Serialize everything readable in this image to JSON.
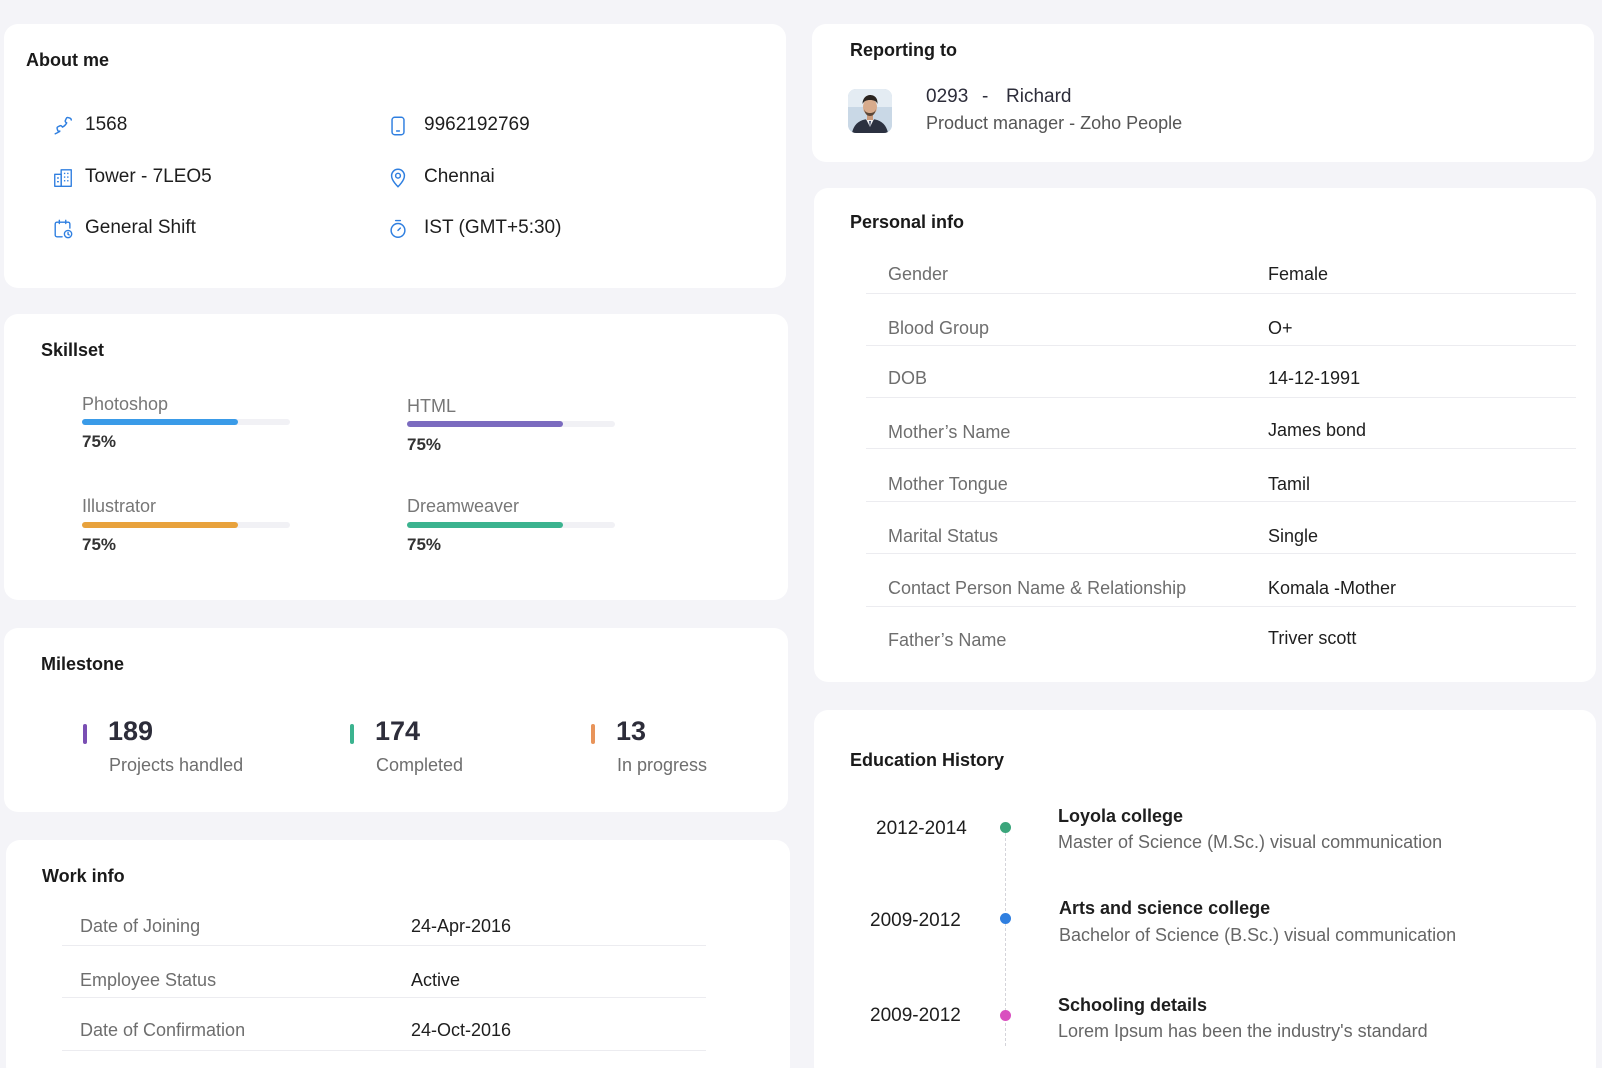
{
  "colors": {
    "accent_blue": "#2f7fe0",
    "photoshop": "#3a9be8",
    "html": "#7b6bbf",
    "illustrator": "#e8a23c",
    "dreamweaver": "#3bb38f",
    "projects": "#7a4fb3",
    "completed": "#3bb38f",
    "in_progress": "#e8945a",
    "edu_1": "#3aa57b",
    "edu_2": "#2f7fe0",
    "edu_3": "#d94fbf"
  },
  "about": {
    "title": "About me",
    "extension": "1568",
    "mobile": "9962192769",
    "seat": "Tower - 7LEO5",
    "location": "Chennai",
    "shift": "General Shift",
    "timezone": "IST (GMT+5:30)",
    "icons": [
      "phone-icon",
      "mobile-icon",
      "building-icon",
      "location-pin-icon",
      "calendar-clock-icon",
      "timer-icon"
    ]
  },
  "skillset": {
    "title": "Skillset",
    "items": [
      {
        "name": "Photoshop",
        "percent": "75%",
        "level": 0.75
      },
      {
        "name": "HTML",
        "percent": "75%",
        "level": 0.75
      },
      {
        "name": "Illustrator",
        "percent": "75%",
        "level": 0.75
      },
      {
        "name": "Dreamweaver",
        "percent": "75%",
        "level": 0.75
      }
    ]
  },
  "milestone": {
    "title": "Milestone",
    "items": [
      {
        "value": "189",
        "label": "Projects handled"
      },
      {
        "value": "174",
        "label": "Completed"
      },
      {
        "value": "13",
        "label": "In progress"
      }
    ]
  },
  "work_info": {
    "title": "Work info",
    "rows": [
      {
        "label": "Date of Joining",
        "value": "24-Apr-2016"
      },
      {
        "label": "Employee Status",
        "value": "Active"
      },
      {
        "label": "Date of Confirmation",
        "value": "24-Oct-2016"
      }
    ]
  },
  "reporting": {
    "title": "Reporting to",
    "id": "0293",
    "separator": "-",
    "name": "Richard",
    "designation": "Product manager - Zoho People"
  },
  "personal_info": {
    "title": "Personal info",
    "rows": [
      {
        "label": "Gender",
        "value": "Female"
      },
      {
        "label": "Blood Group",
        "value": "O+"
      },
      {
        "label": "DOB",
        "value": "14-12-1991"
      },
      {
        "label": "Mother’s Name",
        "value": "James bond"
      },
      {
        "label": "Mother Tongue",
        "value": "Tamil"
      },
      {
        "label": "Marital Status",
        "value": "Single"
      },
      {
        "label": "Contact Person Name & Relationship",
        "value": "Komala -Mother"
      },
      {
        "label": "Father’s Name",
        "value": "Triver scott"
      }
    ]
  },
  "education": {
    "title": "Education History",
    "items": [
      {
        "years": "2012-2014",
        "institution": "Loyola college",
        "detail": "Master of Science (M.Sc.) visual communication"
      },
      {
        "years": "2009-2012",
        "institution": "Arts and science college",
        "detail": "Bachelor of Science (B.Sc.) visual communication"
      },
      {
        "years": "2009-2012",
        "institution": "Schooling details",
        "detail": "Lorem Ipsum has been the industry's standard"
      }
    ]
  }
}
